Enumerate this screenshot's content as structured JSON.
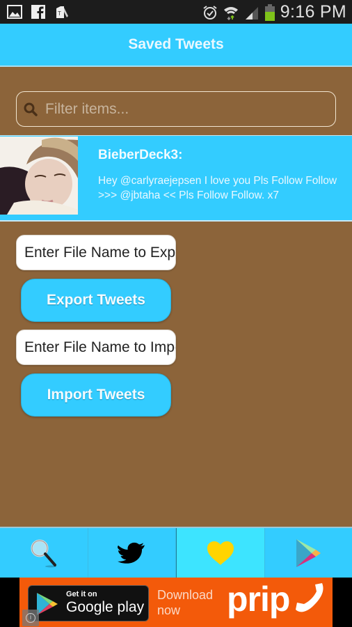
{
  "status_bar": {
    "time": "9:16 PM",
    "left_icons": [
      "gallery-icon",
      "facebook-icon",
      "sim-toolkit-icon"
    ],
    "right_icons": [
      "alarm-icon",
      "wifi-icon",
      "signal-icon",
      "battery-icon"
    ]
  },
  "header": {
    "title": "Saved Tweets"
  },
  "filter": {
    "placeholder": "Filter items...",
    "value": ""
  },
  "tweets": [
    {
      "user": "BieberDeck3:",
      "text": "Hey @carlyraejepsen I love you Pls Follow Follow >>> @jbtaha << Pls Follow Follow. x7"
    }
  ],
  "export": {
    "placeholder": "Enter File Name to Export",
    "button_label": "Export Tweets"
  },
  "import": {
    "placeholder": "Enter File Name to Import",
    "button_label": "Import Tweets"
  },
  "tabbar": {
    "tabs": [
      {
        "name": "search",
        "icon": "magnifier-icon",
        "active": false
      },
      {
        "name": "twitter",
        "icon": "twitter-bird-icon",
        "active": false
      },
      {
        "name": "saved",
        "icon": "heart-icon",
        "active": true
      },
      {
        "name": "play-store",
        "icon": "play-store-icon",
        "active": false
      }
    ]
  },
  "ad": {
    "get_it_on": "Get it on",
    "google_play": "Google play",
    "download": "Download",
    "now": "now",
    "brand": "prip"
  },
  "colors": {
    "accent": "#33ccff",
    "background": "#8c643a",
    "active_tab": "#3de4ff",
    "heart": "#ffd400",
    "ad_orange": "#f35a0a"
  }
}
